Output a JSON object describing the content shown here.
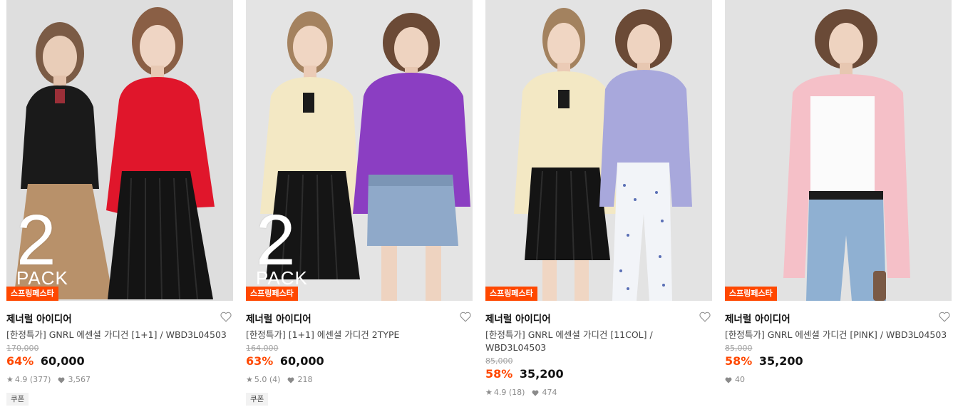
{
  "products": [
    {
      "badge": "스프링페스타",
      "pack_num": "2",
      "pack_label": "PACK",
      "brand": "제너럴 아이디어",
      "title": "[한정특가] GNRL 에센셜 가디건 [1+1] / WBD3L04503",
      "original_price": "170,000",
      "discount": "64%",
      "price": "60,000",
      "rating": "4.9",
      "reviews": "(377)",
      "likes": "3,567",
      "coupon": "쿠폰"
    },
    {
      "badge": "스프링페스타",
      "pack_num": "2",
      "pack_label": "PACK",
      "brand": "제너럴 아이디어",
      "title": "[한정특가] [1+1] 에센셜 가디건 2TYPE",
      "original_price": "164,000",
      "discount": "63%",
      "price": "60,000",
      "rating": "5.0",
      "reviews": "(4)",
      "likes": "218",
      "coupon": "쿠폰"
    },
    {
      "badge": "스프링페스타",
      "brand": "제너럴 아이디어",
      "title": "[한정특가] GNRL 에센셜 가디건 [11COL] / WBD3L04503",
      "original_price": "85,000",
      "discount": "58%",
      "price": "35,200",
      "rating": "4.9",
      "reviews": "(18)",
      "likes": "474"
    },
    {
      "badge": "스프링페스타",
      "brand": "제너럴 아이디어",
      "title": "[한정특가] GNRL 에센셜 가디건 [PINK] / WBD3L04503",
      "original_price": "85,000",
      "discount": "58%",
      "price": "35,200",
      "likes": "40"
    }
  ],
  "icons": {
    "wishlist": "heart-outline-icon",
    "rating": "star-icon",
    "likes": "heart-filled-icon"
  },
  "colors": {
    "accent": "#ff4800",
    "muted": "#8a8a8a"
  }
}
